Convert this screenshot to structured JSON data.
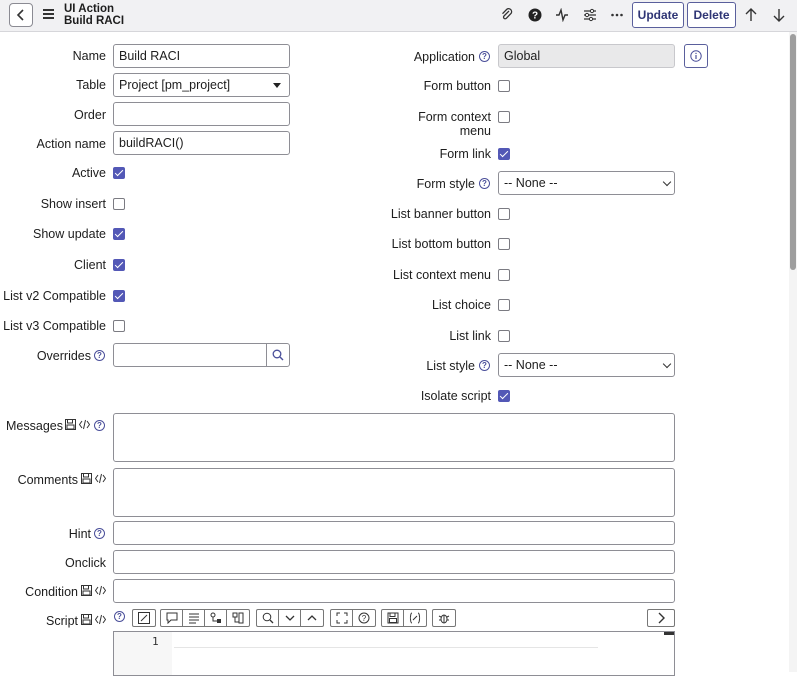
{
  "header": {
    "title": "UI Action",
    "subtitle": "Build RACI",
    "update_label": "Update",
    "delete_label": "Delete"
  },
  "left": {
    "name": {
      "label": "Name",
      "value": "Build RACI"
    },
    "table": {
      "label": "Table",
      "value": "Project [pm_project]"
    },
    "order": {
      "label": "Order",
      "value": ""
    },
    "action_name": {
      "label": "Action name",
      "value": "buildRACI()"
    },
    "active": {
      "label": "Active",
      "checked": true
    },
    "show_insert": {
      "label": "Show insert",
      "checked": false
    },
    "show_update": {
      "label": "Show update",
      "checked": true
    },
    "client": {
      "label": "Client",
      "checked": true
    },
    "list_v2": {
      "label": "List v2 Compatible",
      "checked": true
    },
    "list_v3": {
      "label": "List v3 Compatible",
      "checked": false
    },
    "overrides": {
      "label": "Overrides",
      "value": ""
    }
  },
  "right": {
    "application": {
      "label": "Application",
      "value": "Global"
    },
    "form_button": {
      "label": "Form button",
      "checked": false
    },
    "form_context_menu": {
      "label1": "Form context",
      "label2": "menu",
      "checked": false
    },
    "form_link": {
      "label": "Form link",
      "checked": true
    },
    "form_style": {
      "label": "Form style",
      "value": "-- None --"
    },
    "list_banner_button": {
      "label": "List banner button",
      "checked": false
    },
    "list_bottom_button": {
      "label": "List bottom button",
      "checked": false
    },
    "list_context_menu": {
      "label": "List context menu",
      "checked": false
    },
    "list_choice": {
      "label": "List choice",
      "checked": false
    },
    "list_link": {
      "label": "List link",
      "checked": false
    },
    "list_style": {
      "label": "List style",
      "value": "-- None --"
    },
    "isolate_script": {
      "label": "Isolate script",
      "checked": true
    }
  },
  "bottom": {
    "messages": {
      "label": "Messages"
    },
    "comments": {
      "label": "Comments"
    },
    "hint": {
      "label": "Hint"
    },
    "onclick": {
      "label": "Onclick"
    },
    "condition": {
      "label": "Condition"
    },
    "script": {
      "label": "Script",
      "line1": "1"
    }
  },
  "colors": {
    "accent": "#5358b6",
    "header_bg": "#f1f1f3"
  }
}
